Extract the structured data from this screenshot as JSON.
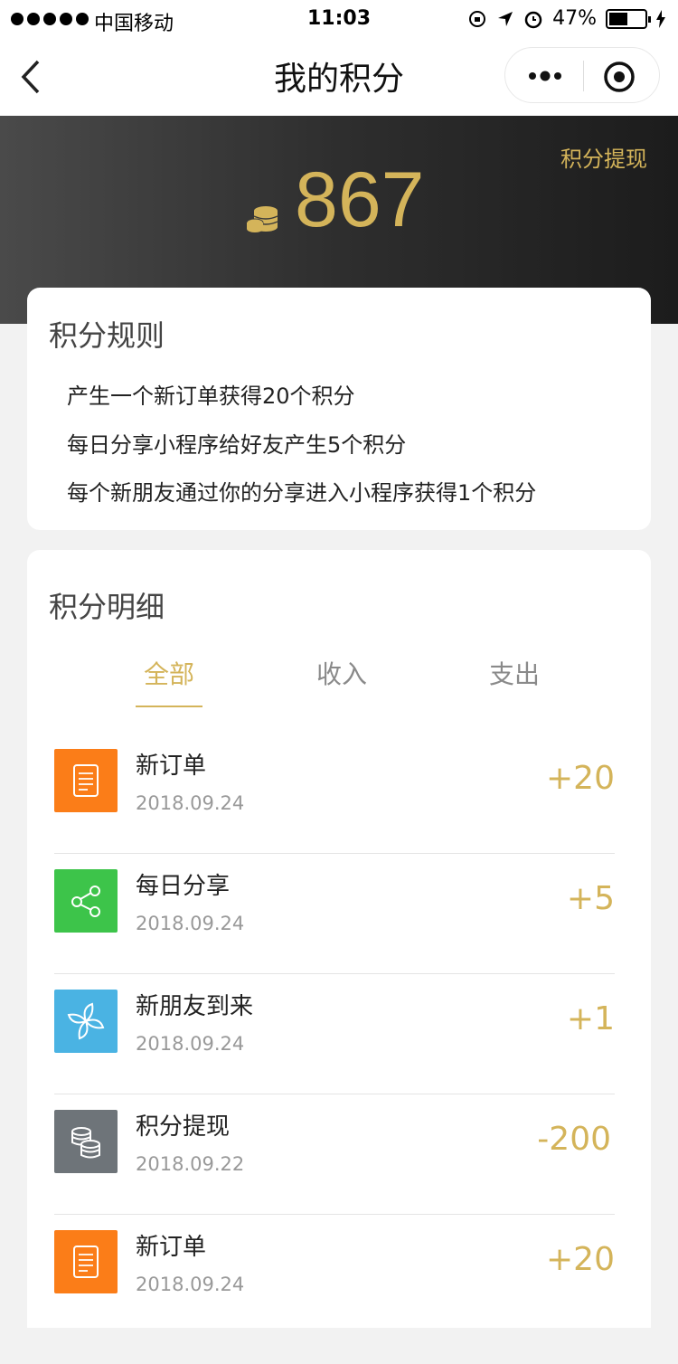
{
  "status_bar": {
    "carrier": "中国移动",
    "time": "11:03",
    "battery": "47%"
  },
  "nav": {
    "title": "我的积分"
  },
  "header": {
    "withdraw_label": "积分提现",
    "points": "867"
  },
  "rules": {
    "title": "积分规则",
    "items": [
      "产生一个新订单获得20个积分",
      "每日分享小程序给好友产生5个积分",
      "每个新朋友通过你的分享进入小程序获得1个积分"
    ]
  },
  "details": {
    "title": "积分明细",
    "tabs": [
      "全部",
      "收入",
      "支出"
    ],
    "active_tab": "全部",
    "records": [
      {
        "name": "新订单",
        "date": "2018.09.24",
        "amount": "+20",
        "icon": "order-icon",
        "color": "#fb7d18"
      },
      {
        "name": "每日分享",
        "date": "2018.09.24",
        "amount": "+5",
        "icon": "share-icon",
        "color": "#3dc44a"
      },
      {
        "name": "新朋友到来",
        "date": "2018.09.24",
        "amount": "+1",
        "icon": "pinwheel-icon",
        "color": "#4ab3e3"
      },
      {
        "name": "积分提现",
        "date": "2018.09.22",
        "amount": "-200",
        "icon": "coins-stack-icon",
        "color": "#6e7479"
      },
      {
        "name": "新订单",
        "date": "2018.09.24",
        "amount": "+20",
        "icon": "order-icon",
        "color": "#fb7d18"
      }
    ]
  },
  "colors": {
    "accent_gold": "#d4b45a",
    "header_dark": "#2e2e2e"
  }
}
